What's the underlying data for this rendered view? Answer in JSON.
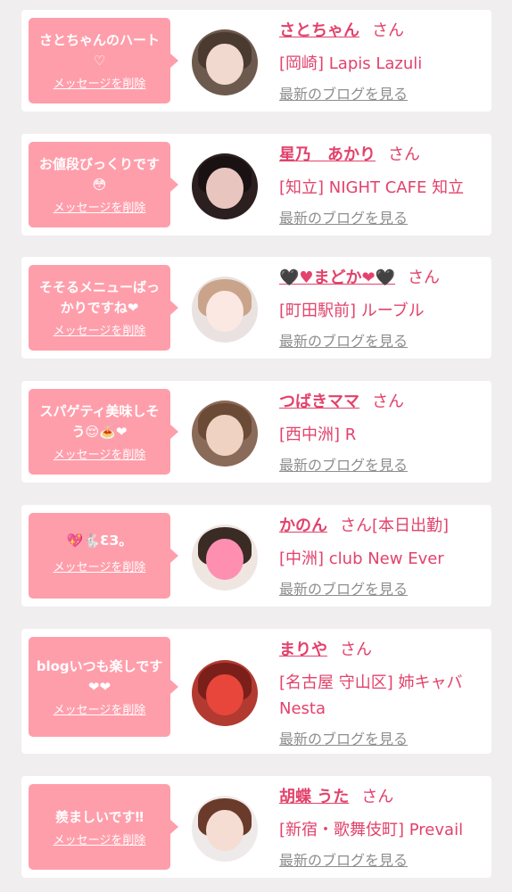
{
  "colors": {
    "background": "#f0eeef",
    "card": "#ffffff",
    "bubble": "#ff9eab",
    "accent": "#e2426b",
    "link_gray": "#8e8e8e"
  },
  "items": [
    {
      "message": "さとちゃんのハート♡",
      "delete_label": "メッセージを削除",
      "name": "さとちゃん",
      "suffix": "さん",
      "name_extra": "",
      "shop": "[岡崎] Lapis Lazuli",
      "blog_label": "最新のブログを見る",
      "avatar_icon": "user-photo-icon"
    },
    {
      "message": "お値段びっくりです😳",
      "delete_label": "メッセージを削除",
      "name": "星乃　あかり",
      "suffix": "さん",
      "name_extra": "",
      "shop": "[知立] NIGHT CAFE 知立",
      "blog_label": "最新のブログを見る",
      "avatar_icon": "user-photo-icon"
    },
    {
      "message": "そそるメニューばっかりですね❤",
      "delete_label": "メッセージを削除",
      "name": "🖤♥まどか❤🖤",
      "suffix": "さん",
      "name_extra": "",
      "shop": "[町田駅前] ルーブル",
      "blog_label": "最新のブログを見る",
      "avatar_icon": "user-photo-icon"
    },
    {
      "message": "スパゲティ美味しそう😌🍝❤",
      "delete_label": "メッセージを削除",
      "name": "つばきママ",
      "suffix": "さん",
      "name_extra": "",
      "shop": "[西中洲] R",
      "blog_label": "最新のブログを見る",
      "avatar_icon": "user-photo-icon"
    },
    {
      "message": "💖🐇ƐЗ。",
      "delete_label": "メッセージを削除",
      "name": "かのん",
      "suffix": "さん",
      "name_extra": "[本日出勤]",
      "shop": "[中洲] club New Ever",
      "blog_label": "最新のブログを見る",
      "avatar_icon": "user-photo-icon"
    },
    {
      "message": "blogいつも楽しです❤❤",
      "delete_label": "メッセージを削除",
      "name": "まりや",
      "suffix": "さん",
      "name_extra": "",
      "shop": "[名古屋 守山区] 姉キャバ Nesta",
      "blog_label": "最新のブログを見る",
      "avatar_icon": "user-photo-icon"
    },
    {
      "message": "羨ましいです‼",
      "delete_label": "メッセージを削除",
      "name": "胡蝶 うた",
      "suffix": "さん",
      "name_extra": "",
      "shop": "[新宿・歌舞伎町] Prevail",
      "blog_label": "最新のブログを見る",
      "avatar_icon": "user-photo-icon"
    }
  ]
}
